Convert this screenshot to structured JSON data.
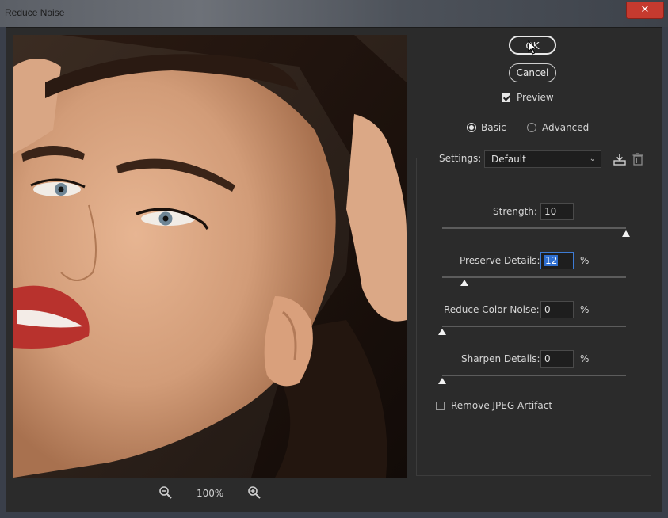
{
  "window": {
    "title": "Reduce Noise",
    "close_glyph": "✕"
  },
  "buttons": {
    "ok": "OK",
    "cancel": "Cancel"
  },
  "preview_toggle": {
    "label": "Preview",
    "checked": true
  },
  "mode": {
    "options": [
      "Basic",
      "Advanced"
    ],
    "selected": "Basic"
  },
  "settings": {
    "label": "Settings:",
    "value": "Default"
  },
  "sliders": [
    {
      "label": "Strength:",
      "value": "10",
      "unit": "",
      "fraction": 1.0,
      "selected": false
    },
    {
      "label": "Preserve Details:",
      "value": "12",
      "unit": "%",
      "fraction": 0.12,
      "selected": true
    },
    {
      "label": "Reduce Color Noise:",
      "value": "0",
      "unit": "%",
      "fraction": 0.0,
      "selected": false
    },
    {
      "label": "Sharpen Details:",
      "value": "0",
      "unit": "%",
      "fraction": 0.0,
      "selected": false
    }
  ],
  "remove_jpeg": {
    "label": "Remove JPEG Artifact",
    "checked": false
  },
  "zoom": {
    "level": "100%"
  },
  "colors": {
    "close": "#c53a2f",
    "selection": "#2f6fd0",
    "dialog_bg": "#2b2b2b"
  }
}
